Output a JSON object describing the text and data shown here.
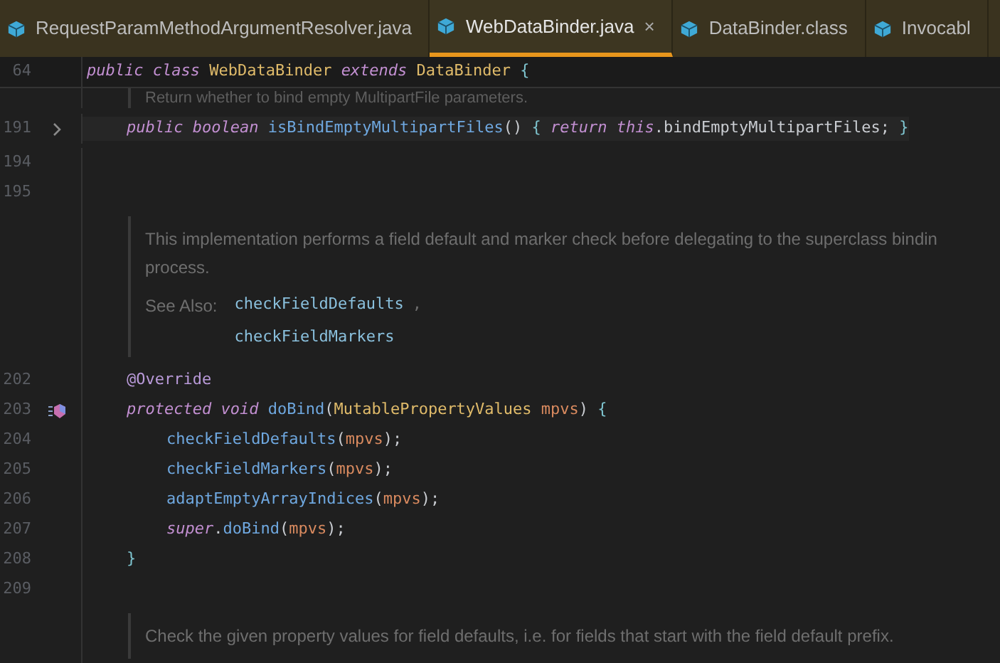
{
  "tabs": [
    {
      "label": "RequestParamMethodArgumentResolver.java",
      "selected": false,
      "closable": false
    },
    {
      "label": "WebDataBinder.java",
      "selected": true,
      "closable": true,
      "close": "×"
    },
    {
      "label": "DataBinder.class",
      "selected": false,
      "closable": false
    },
    {
      "label": "Invocabl",
      "selected": false,
      "closable": false
    }
  ],
  "sticky_line": {
    "number": "64",
    "tokens": [
      {
        "t": "public class ",
        "kind": "keyword"
      },
      {
        "t": "WebDataBinder ",
        "kind": "type"
      },
      {
        "t": "extends ",
        "kind": "keyword"
      },
      {
        "t": "DataBinder ",
        "kind": "type"
      },
      {
        "t": "{",
        "kind": "brace"
      }
    ]
  },
  "partial_doc": "Return whether to bind empty MultipartFile parameters.",
  "lines": [
    {
      "kind": "code",
      "number": "191",
      "folded": true,
      "override": false,
      "tokens": [
        {
          "t": "public boolean ",
          "kind": "keyword"
        },
        {
          "t": "isBindEmptyMultipartFiles",
          "kind": "method"
        },
        {
          "t": "() ",
          "kind": "plain"
        },
        {
          "t": "{ ",
          "kind": "brace"
        },
        {
          "t": "return this",
          "kind": "keyword"
        },
        {
          "t": ".bindEmptyMultipartFiles; ",
          "kind": "plain"
        },
        {
          "t": "}",
          "kind": "brace"
        }
      ]
    },
    {
      "kind": "blank",
      "number": "194"
    },
    {
      "kind": "blank",
      "number": "195"
    },
    {
      "kind": "doc",
      "text_lines": [
        "This implementation performs a field default and marker check before delegating to the superclass bindin",
        "process."
      ],
      "see_also_label": "See Also:",
      "links": [
        "checkFieldDefaults",
        "checkFieldMarkers"
      ],
      "separator": ","
    },
    {
      "kind": "code",
      "number": "202",
      "folded": false,
      "override": false,
      "tokens": [
        {
          "t": "@Override",
          "kind": "annotation"
        }
      ]
    },
    {
      "kind": "code",
      "number": "203",
      "folded": false,
      "override": true,
      "tokens": [
        {
          "t": "protected void ",
          "kind": "keyword"
        },
        {
          "t": "doBind",
          "kind": "method"
        },
        {
          "t": "(",
          "kind": "plain"
        },
        {
          "t": "MutablePropertyValues ",
          "kind": "type"
        },
        {
          "t": "mpvs",
          "kind": "param"
        },
        {
          "t": ") ",
          "kind": "plain"
        },
        {
          "t": "{",
          "kind": "brace"
        }
      ],
      "children": [
        {
          "kind": "code",
          "number": "204",
          "folded": false,
          "override": false,
          "tokens": [
            {
              "t": "checkFieldDefaults",
              "kind": "method"
            },
            {
              "t": "(",
              "kind": "plain"
            },
            {
              "t": "mpvs",
              "kind": "param"
            },
            {
              "t": ");",
              "kind": "plain"
            }
          ]
        },
        {
          "kind": "code",
          "number": "205",
          "folded": false,
          "override": false,
          "tokens": [
            {
              "t": "checkFieldMarkers",
              "kind": "method"
            },
            {
              "t": "(",
              "kind": "plain"
            },
            {
              "t": "mpvs",
              "kind": "param"
            },
            {
              "t": ");",
              "kind": "plain"
            }
          ]
        },
        {
          "kind": "code",
          "number": "206",
          "folded": false,
          "override": false,
          "tokens": [
            {
              "t": "adaptEmptyArrayIndices",
              "kind": "method"
            },
            {
              "t": "(",
              "kind": "plain"
            },
            {
              "t": "mpvs",
              "kind": "param"
            },
            {
              "t": ");",
              "kind": "plain"
            }
          ]
        },
        {
          "kind": "code",
          "number": "207",
          "folded": false,
          "override": false,
          "tokens": [
            {
              "t": "super",
              "kind": "keyword"
            },
            {
              "t": ".",
              "kind": "plain"
            },
            {
              "t": "doBind",
              "kind": "method"
            },
            {
              "t": "(",
              "kind": "plain"
            },
            {
              "t": "mpvs",
              "kind": "param"
            },
            {
              "t": ");",
              "kind": "plain"
            }
          ]
        }
      ]
    },
    {
      "kind": "code",
      "number": "208",
      "folded": false,
      "override": false,
      "tokens": [
        {
          "t": "}",
          "kind": "brace"
        }
      ]
    },
    {
      "kind": "blank",
      "number": "209"
    },
    {
      "kind": "doc",
      "text_lines": [
        "Check the given property values for field defaults, i.e. for fields that start with the field default prefix."
      ]
    }
  ]
}
